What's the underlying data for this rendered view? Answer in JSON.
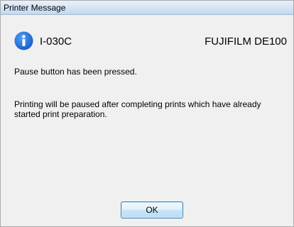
{
  "window": {
    "title": "Printer Message"
  },
  "message": {
    "icon": "info-icon",
    "code": "I-030C",
    "model": "FUJIFILM DE100",
    "line1": "Pause button has been pressed.",
    "line2": "Printing will be paused after completing prints which have already started print preparation."
  },
  "buttons": {
    "ok_label": "OK"
  },
  "colors": {
    "info_icon": "#1e6fd9"
  }
}
